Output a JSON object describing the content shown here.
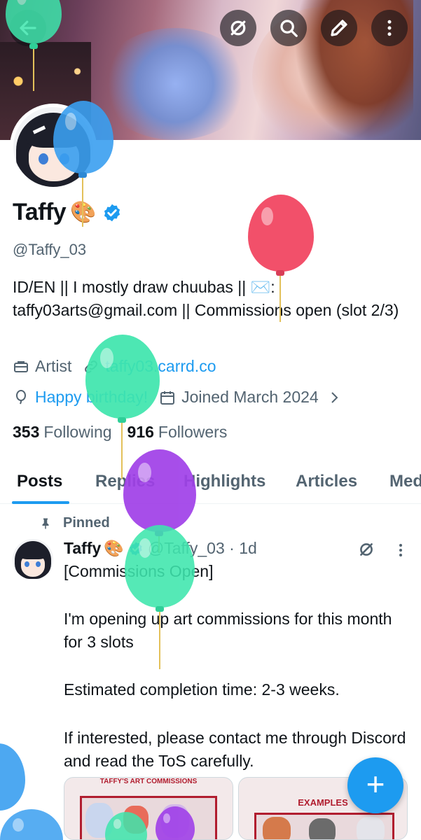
{
  "header": {
    "back_icon": "back-arrow-icon",
    "actions": [
      "grok-icon",
      "search-icon",
      "edit-icon",
      "more-vertical-icon"
    ]
  },
  "profile": {
    "name": "Taffy",
    "name_emoji": "🎨",
    "handle": "@Taffy_03",
    "bio": "ID/EN || I mostly draw chuubas || ✉️: taffy03arts@gmail.com || Commissions open (slot 2/3)",
    "category": "Artist",
    "website": "taffy03.carrd.co",
    "birthday_label": "Happy birthday!",
    "joined": "Joined March 2024",
    "following_count": "353",
    "following_label": "Following",
    "followers_count": "916",
    "followers_label": "Followers"
  },
  "tabs": [
    "Posts",
    "Replies",
    "Highlights",
    "Articles",
    "Media"
  ],
  "post": {
    "pinned_label": "Pinned",
    "author": "Taffy",
    "author_emoji": "🎨",
    "handle_time": "@Taffy_03 · 1d",
    "lines": [
      "[Commissions Open]",
      "",
      "I'm opening up art commissions for this month for 3 slots",
      "",
      "Estimated completion time: 2-3 weeks.",
      "",
      "If interested, please contact me through Discord and read the ToS carefully."
    ],
    "media": [
      {
        "title": "TAFFY'S ART COMMISSIONS"
      },
      {
        "title": "EXAMPLES"
      }
    ]
  },
  "fab_label": "+",
  "colors": {
    "accent": "#1d9bf0",
    "text": "#0f1419",
    "muted": "#536471",
    "balloon_blue": "#3a9ff0",
    "balloon_red": "#f2506a",
    "balloon_green": "#3ee6ad",
    "balloon_purple": "#a040e8"
  }
}
